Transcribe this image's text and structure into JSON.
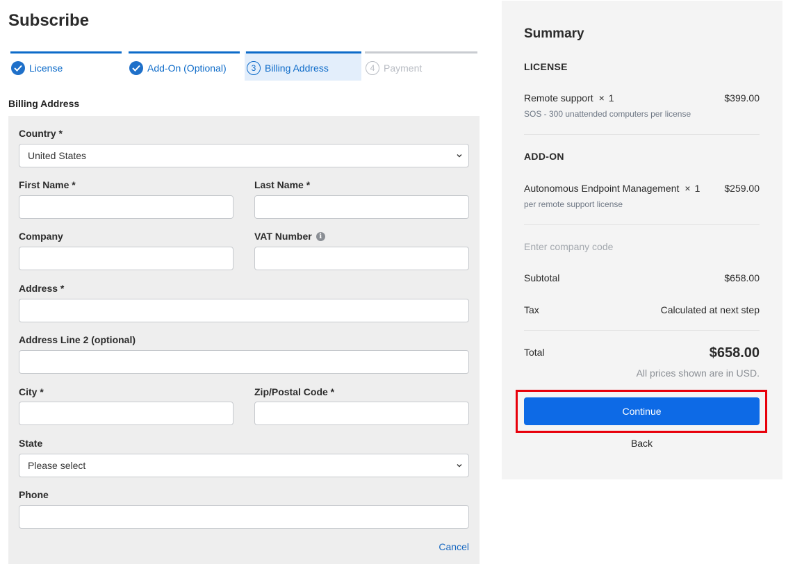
{
  "page": {
    "title": "Subscribe"
  },
  "steps": [
    {
      "label": "License",
      "state": "done"
    },
    {
      "label": "Add-On (Optional)",
      "state": "done"
    },
    {
      "number": "3",
      "label": "Billing Address",
      "state": "active"
    },
    {
      "number": "4",
      "label": "Payment",
      "state": "pending"
    }
  ],
  "billing": {
    "section_title": "Billing Address",
    "country": {
      "label": "Country *",
      "value": "United States"
    },
    "first_name": {
      "label": "First Name *",
      "value": ""
    },
    "last_name": {
      "label": "Last Name *",
      "value": ""
    },
    "company": {
      "label": "Company",
      "value": ""
    },
    "vat_number": {
      "label": "VAT Number",
      "value": "",
      "icon": "info-icon"
    },
    "address": {
      "label": "Address *",
      "value": ""
    },
    "address2": {
      "label": "Address Line 2 (optional)",
      "value": ""
    },
    "city": {
      "label": "City *",
      "value": ""
    },
    "zip": {
      "label": "Zip/Postal Code *",
      "value": ""
    },
    "state": {
      "label": "State",
      "value": "Please select"
    },
    "phone": {
      "label": "Phone",
      "value": ""
    },
    "cancel_label": "Cancel"
  },
  "summary": {
    "title": "Summary",
    "license_heading": "LICENSE",
    "license_item": {
      "name": "Remote support",
      "times": "×",
      "qty": "1",
      "price": "$399.00",
      "description": "SOS - 300 unattended computers per license"
    },
    "addon_heading": "ADD-ON",
    "addon_item": {
      "name": "Autonomous Endpoint Management",
      "times": "×",
      "qty": "1",
      "price": "$259.00",
      "description": "per remote support license"
    },
    "company_code_placeholder": "Enter company code",
    "subtotal_label": "Subtotal",
    "subtotal_value": "$658.00",
    "tax_label": "Tax",
    "tax_value": "Calculated at next step",
    "total_label": "Total",
    "total_value": "$658.00",
    "currency_note": "All prices shown are in USD.",
    "continue_label": "Continue",
    "back_label": "Back"
  },
  "colors": {
    "accent": "#0d6bc9",
    "primary_button": "#0d6ae6",
    "highlight_border": "#e8000b",
    "panel_bg": "#eeeeee",
    "summary_bg": "#f4f4f4"
  }
}
